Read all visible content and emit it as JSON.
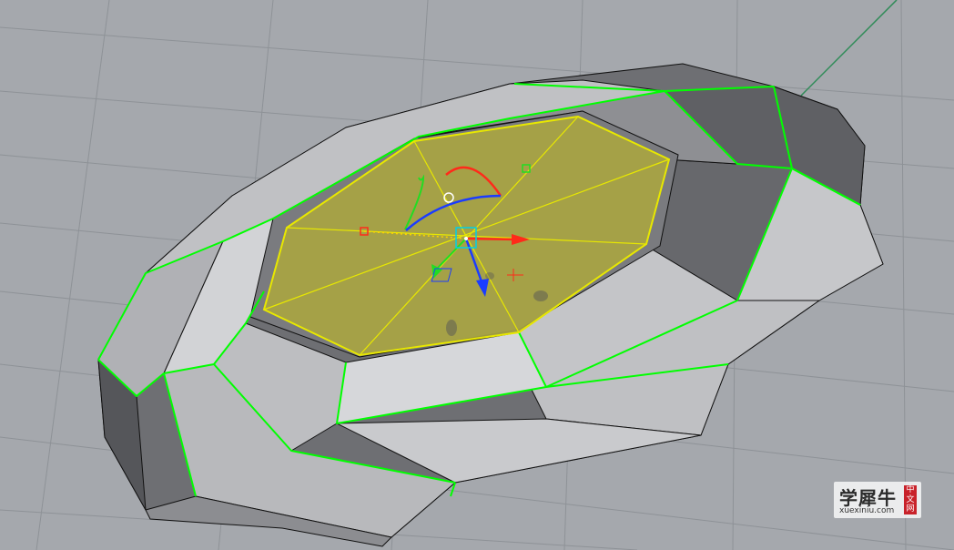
{
  "viewport": {
    "background": "#a5a8ad",
    "grid_color": "#8e9297",
    "axis_color": "#2e8b57",
    "model_face_color": "#b9babd",
    "model_side_color": "#6e6f73",
    "selected_face_fill": "#a8a442",
    "selected_edge_color": "#e8e800",
    "highlight_edge_color": "#00ff00",
    "gumball": {
      "x_axis_color": "#ff2a1a",
      "y_axis_color": "#22dd22",
      "z_axis_color": "#1a3cff",
      "icons": [
        "move-arrow-icon",
        "rotate-arc-icon",
        "scale-handle-icon"
      ]
    }
  },
  "watermark": {
    "title": "学犀牛",
    "url": "xuexiniu.com",
    "seal_chars": [
      "中",
      "文",
      "网"
    ]
  }
}
